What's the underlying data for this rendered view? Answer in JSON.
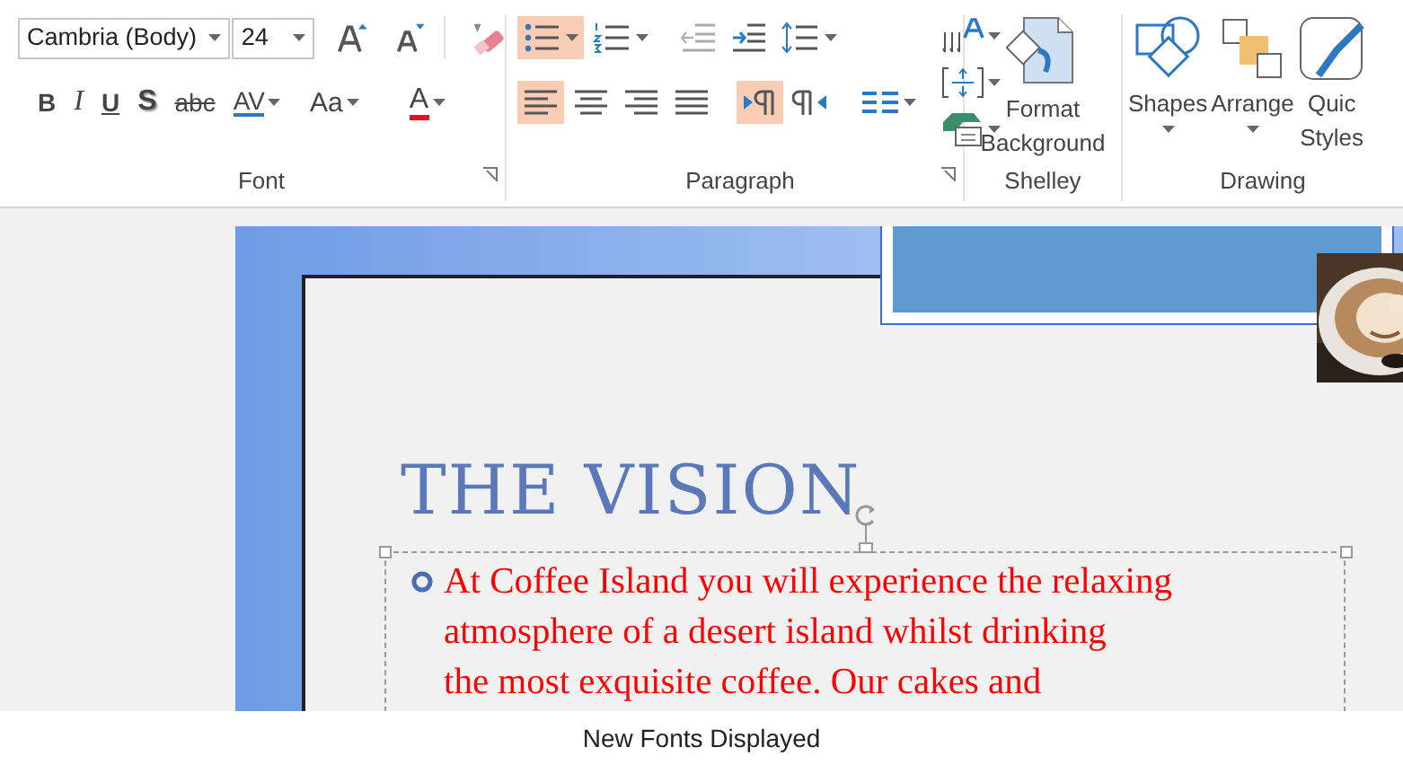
{
  "ribbon": {
    "font": {
      "font_name": "Cambria (Body)",
      "font_size": "24",
      "label": "Font",
      "format_buttons": [
        {
          "kind": "bold",
          "label": "B"
        },
        {
          "kind": "italic",
          "label": "I"
        },
        {
          "kind": "underline",
          "label": "U"
        },
        {
          "kind": "shadow",
          "label": "S"
        },
        {
          "kind": "strike",
          "label": "abc"
        },
        {
          "kind": "spacing",
          "label": "AV"
        },
        {
          "kind": "case",
          "label": "Aa"
        },
        {
          "kind": "color",
          "label": "A",
          "color": "#e81123"
        }
      ]
    },
    "paragraph": {
      "label": "Paragraph",
      "row_1": [
        {
          "kind": "bullets",
          "selected": true
        },
        {
          "kind": "numbering",
          "selected": false
        },
        {
          "kind": "outdent",
          "selected": false
        },
        {
          "kind": "indent",
          "selected": false
        },
        {
          "kind": "spacing",
          "selected": false
        }
      ],
      "row_2": [
        {
          "kind": "left",
          "selected": true
        },
        {
          "kind": "center",
          "selected": false
        },
        {
          "kind": "right",
          "selected": false
        },
        {
          "kind": "justify",
          "selected": false
        },
        {
          "kind": "ltr",
          "selected": true
        },
        {
          "kind": "rtl",
          "selected": false
        },
        {
          "kind": "columns",
          "selected": false
        }
      ]
    },
    "shelley": {
      "label": "Shelley",
      "button": [
        "Format",
        "Background"
      ]
    },
    "drawing": {
      "label": "Drawing",
      "buttons": [
        {
          "kind": "shapes",
          "lines": [
            "Shapes"
          ]
        },
        {
          "kind": "arrange",
          "lines": [
            "Arrange"
          ]
        },
        {
          "kind": "styles",
          "lines": [
            "Quic",
            "Styles"
          ]
        }
      ]
    }
  },
  "slide": {
    "title": "THE VISION",
    "body_lines": [
      "At Coffee Island you will experience the relaxing",
      "atmosphere of a desert island whilst drinking",
      "the most exquisite coffee. Our cakes and"
    ]
  },
  "caption": "New Fonts Displayed"
}
